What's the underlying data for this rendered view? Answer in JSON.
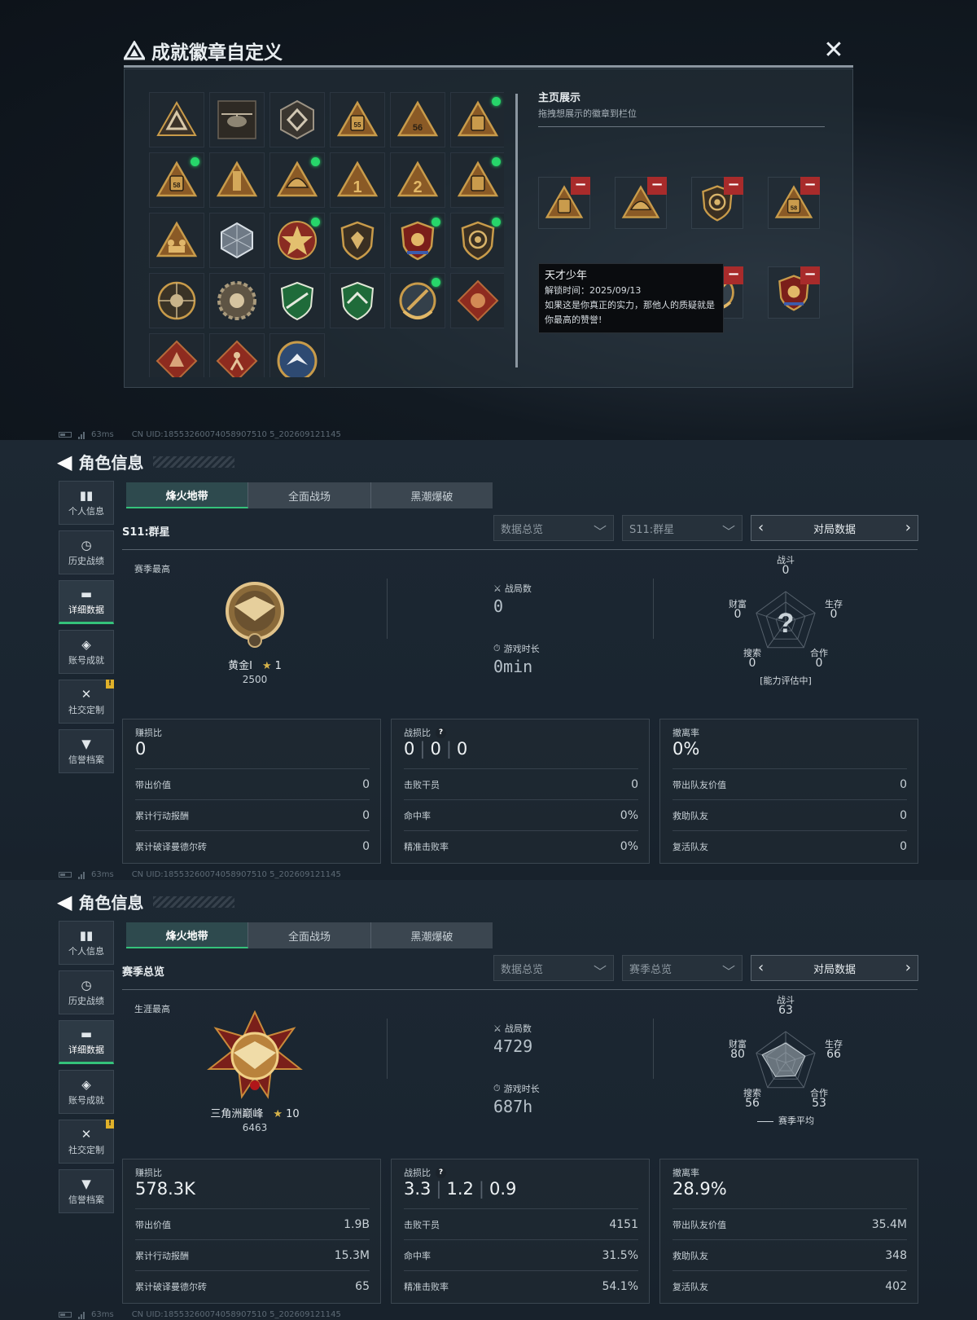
{
  "modal": {
    "title": "成就徽章自定义",
    "close_icon": "close-icon",
    "showcase_title": "主页展示",
    "showcase_hint": "拖拽想展示的徽章到栏位",
    "grid_badges": [
      {
        "icon": "triangle-logo-badge",
        "new": false
      },
      {
        "icon": "helicopter-badge",
        "new": false
      },
      {
        "icon": "hex-emblem-badge",
        "new": false
      },
      {
        "icon": "backpack-55-badge",
        "new": false
      },
      {
        "icon": "triangle-56-badge",
        "new": false
      },
      {
        "icon": "backpack-tower-badge",
        "new": true
      },
      {
        "icon": "backpack-58-badge",
        "new": true
      },
      {
        "icon": "tower-badge",
        "new": false
      },
      {
        "icon": "helmet-badge",
        "new": true
      },
      {
        "icon": "triangle-1-badge",
        "new": false
      },
      {
        "icon": "triangle-2-badge",
        "new": false
      },
      {
        "icon": "backpack-badge",
        "new": true
      },
      {
        "icon": "soldiers-badge",
        "new": false
      },
      {
        "icon": "cube-badge",
        "new": false
      },
      {
        "icon": "star-medal-badge",
        "new": true
      },
      {
        "icon": "shield-badge",
        "new": false
      },
      {
        "icon": "eagle-shield-badge",
        "new": true
      },
      {
        "icon": "lion-shield-badge",
        "new": true
      },
      {
        "icon": "skull-crosshair-badge",
        "new": false
      },
      {
        "icon": "gear-skull-badge",
        "new": false
      },
      {
        "icon": "green-rifle-badge",
        "new": false
      },
      {
        "icon": "green-wing-badge",
        "new": false
      },
      {
        "icon": "gold-wreath-badge",
        "new": true
      },
      {
        "icon": "dragon-diamond-badge",
        "new": false
      },
      {
        "icon": "wolf-diamond-badge",
        "new": false
      },
      {
        "icon": "runner-diamond-badge",
        "new": false
      },
      {
        "icon": "bird-circle-badge",
        "new": false
      }
    ],
    "showcase_slots": [
      {
        "icon": "backpack-tower-badge"
      },
      {
        "icon": "helmet-badge"
      },
      {
        "icon": "lion-shield-badge"
      },
      {
        "icon": "backpack-58-badge"
      },
      {
        "icon": "triangle-logo-badge"
      },
      {
        "icon": "star-medal-badge"
      },
      {
        "icon": "gold-wreath-badge"
      },
      {
        "icon": "eagle-shield-badge"
      }
    ],
    "tooltip": {
      "title": "天才少年",
      "unlock": "解锁时间：2025/09/13",
      "desc": "如果这是你真正的实力，那他人的质疑就是你最高的赞誉!"
    }
  },
  "status": {
    "ping": "63ms",
    "uid": "CN UID:18553260074058907510 5_202609121145"
  },
  "profiles": [
    {
      "header": "角色信息",
      "sidebar": [
        {
          "label": "个人信息",
          "icon": "bar-chart-icon"
        },
        {
          "label": "历史战绩",
          "icon": "clock-icon"
        },
        {
          "label": "详细数据",
          "icon": "folder-icon",
          "active": true
        },
        {
          "label": "账号成就",
          "icon": "medal-icon"
        },
        {
          "label": "社交定制",
          "icon": "tools-icon",
          "badge": "!"
        },
        {
          "label": "信誉档案",
          "icon": "shield-icon"
        }
      ],
      "tabs": [
        "烽火地带",
        "全面战场",
        "黑潮爆破"
      ],
      "section_label": "S11:群星",
      "dropdown1": "数据总览",
      "dropdown2": "S11:群星",
      "pager_label": "对局数据",
      "best_label": "赛季最高",
      "rank_name": "黄金I",
      "rank_stars": "1",
      "rank_points": "2500",
      "matches_label": "战局数",
      "matches_value": "0",
      "playtime_label": "游戏时长",
      "playtime_value": "0min",
      "radar": {
        "combat_label": "战斗",
        "combat": "0",
        "survival_label": "生存",
        "survival": "0",
        "coop_label": "合作",
        "coop": "0",
        "search_label": "搜索",
        "search": "0",
        "wealth_label": "财富",
        "wealth": "0",
        "note": "[能力评估中]"
      },
      "panels": [
        {
          "label": "赚损比",
          "value": "0",
          "rows": [
            {
              "k": "带出价值",
              "v": "0"
            },
            {
              "k": "累计行动报酬",
              "v": "0"
            },
            {
              "k": "累计破译曼德尔砖",
              "v": "0"
            }
          ]
        },
        {
          "label": "战损比",
          "values": [
            "0",
            "0",
            "0"
          ],
          "rows": [
            {
              "k": "击败干员",
              "v": "0"
            },
            {
              "k": "命中率",
              "v": "0%"
            },
            {
              "k": "精准击败率",
              "v": "0%"
            }
          ]
        },
        {
          "label": "撤离率",
          "value": "0%",
          "rows": [
            {
              "k": "带出队友价值",
              "v": "0"
            },
            {
              "k": "救助队友",
              "v": "0"
            },
            {
              "k": "复活队友",
              "v": "0"
            }
          ]
        }
      ]
    },
    {
      "header": "角色信息",
      "sidebar": [
        {
          "label": "个人信息",
          "icon": "bar-chart-icon"
        },
        {
          "label": "历史战绩",
          "icon": "clock-icon"
        },
        {
          "label": "详细数据",
          "icon": "folder-icon",
          "active": true
        },
        {
          "label": "账号成就",
          "icon": "medal-icon"
        },
        {
          "label": "社交定制",
          "icon": "tools-icon",
          "badge": "!"
        },
        {
          "label": "信誉档案",
          "icon": "shield-icon"
        }
      ],
      "tabs": [
        "烽火地带",
        "全面战场",
        "黑潮爆破"
      ],
      "section_label": "赛季总览",
      "dropdown1": "数据总览",
      "dropdown2": "赛季总览",
      "pager_label": "对局数据",
      "best_label": "生涯最高",
      "rank_name": "三角洲巅峰",
      "rank_stars": "10",
      "rank_points": "6463",
      "matches_label": "战局数",
      "matches_value": "4729",
      "playtime_label": "游戏时长",
      "playtime_value": "687h",
      "radar": {
        "combat_label": "战斗",
        "combat": "63",
        "survival_label": "生存",
        "survival": "66",
        "coop_label": "合作",
        "coop": "53",
        "search_label": "搜索",
        "search": "56",
        "wealth_label": "财富",
        "wealth": "80",
        "note": "赛季平均"
      },
      "panels": [
        {
          "label": "赚损比",
          "value": "578.3K",
          "rows": [
            {
              "k": "带出价值",
              "v": "1.9B"
            },
            {
              "k": "累计行动报酬",
              "v": "15.3M"
            },
            {
              "k": "累计破译曼德尔砖",
              "v": "65"
            }
          ]
        },
        {
          "label": "战损比",
          "values": [
            "3.3",
            "1.2",
            "0.9"
          ],
          "rows": [
            {
              "k": "击败干员",
              "v": "4151"
            },
            {
              "k": "命中率",
              "v": "31.5%"
            },
            {
              "k": "精准击败率",
              "v": "54.1%"
            }
          ]
        },
        {
          "label": "撤离率",
          "value": "28.9%",
          "rows": [
            {
              "k": "带出队友价值",
              "v": "35.4M"
            },
            {
              "k": "救助队友",
              "v": "348"
            },
            {
              "k": "复活队友",
              "v": "402"
            }
          ]
        }
      ]
    }
  ]
}
